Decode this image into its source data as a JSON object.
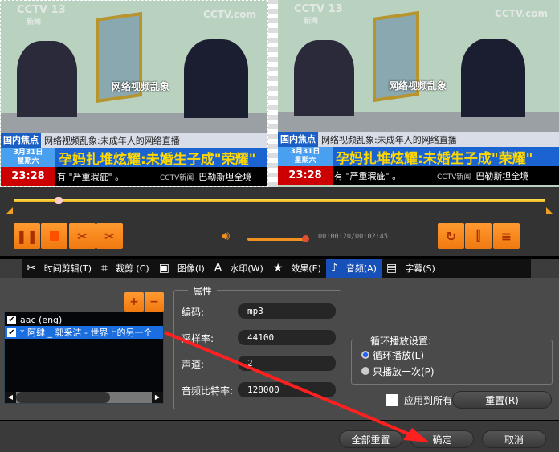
{
  "video": {
    "channel_logo": "CCTV 13",
    "channel_sub": "新闻",
    "watermark": "CCTV.com",
    "screen_caption": "网络视频乱象",
    "section_tag": "国内焦点",
    "subtitle": "网络视频乱象:未成年人的网络直播",
    "date_line1": "3月31日",
    "date_line2": "星期六",
    "headline": "孕妈扎堆炫耀:未婚生子成\"荣耀\"",
    "clock": "23:28",
    "ticker": "有 \"严重瑕疵\" 。",
    "ticker_logo": "CCTV新闻",
    "ticker2": "巴勒斯坦全境"
  },
  "player": {
    "time": "00:00:20/00:02:45",
    "volume_percent": 95,
    "progress_percent": 12
  },
  "tabs": [
    {
      "label": "时间剪辑(T)",
      "icon": "scissors-icon"
    },
    {
      "label": "裁剪 (C)",
      "icon": "crop-icon"
    },
    {
      "label": "图像(I)",
      "icon": "image-icon"
    },
    {
      "label": "水印(W)",
      "icon": "watermark-icon"
    },
    {
      "label": "效果(E)",
      "icon": "star-icon"
    },
    {
      "label": "音频(A)",
      "icon": "music-note-icon"
    },
    {
      "label": "字幕(S)",
      "icon": "subtitle-icon"
    }
  ],
  "audio_list": {
    "add": "+",
    "remove": "−",
    "tracks": [
      {
        "label": "aac (eng)",
        "checked": true
      },
      {
        "label": "* 阿肆 _ 郭采洁 - 世界上的另一个",
        "checked": true
      }
    ]
  },
  "properties": {
    "title": "属性",
    "fields": [
      {
        "label": "编码:",
        "value": "mp3"
      },
      {
        "label": "采样率:",
        "value": "44100"
      },
      {
        "label": "声道:",
        "value": "2"
      },
      {
        "label": "音频比特率:",
        "value": "128000"
      }
    ]
  },
  "loop": {
    "title": "循环播放设置:",
    "options": [
      "循环播放(L)",
      "只播放一次(P)"
    ]
  },
  "apply_all": "应用到所有项目",
  "reset": "重置(R)",
  "footer": {
    "reset_all": "全部重置",
    "ok": "确定",
    "cancel": "取消"
  },
  "colors": {
    "accent": "#f08a20",
    "selected": "#1650b8",
    "arrow": "#ff2020"
  }
}
